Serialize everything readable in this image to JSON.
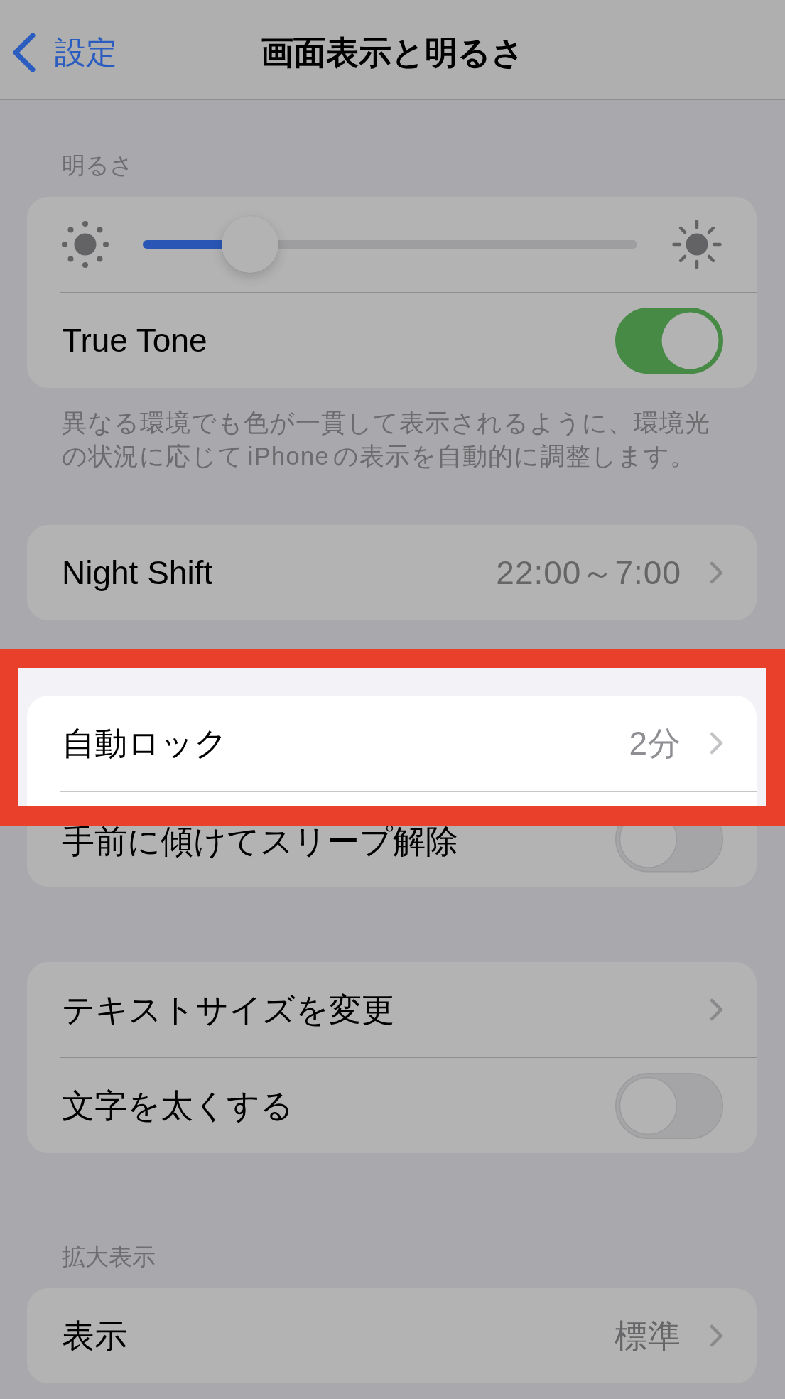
{
  "dimmed": true,
  "nav": {
    "back_label": "設定",
    "title": "画面表示と明るさ"
  },
  "groups": [
    {
      "header": "明るさ",
      "rows": [
        {
          "kind": "slider",
          "level": 0.18,
          "highlighted": false
        },
        {
          "kind": "toggle",
          "label": "True Tone",
          "on": true,
          "highlighted": false
        }
      ],
      "footer": "異なる環境でも色が一貫して表示されるように、環境光の状況に応じて iPhone の表示を自動的に調整します。"
    },
    {
      "rows": [
        {
          "kind": "link",
          "label": "Night Shift",
          "value": "22:00～7:00",
          "highlighted": false
        }
      ]
    },
    {
      "rows": [
        {
          "kind": "link",
          "label": "自動ロック",
          "value": "2分",
          "highlighted": true
        },
        {
          "kind": "toggle",
          "label": "手前に傾けてスリープ解除",
          "on": false,
          "highlighted": false
        }
      ]
    },
    {
      "rows": [
        {
          "kind": "link",
          "label": "テキストサイズを変更",
          "highlighted": false
        },
        {
          "kind": "toggle",
          "label": "文字を太くする",
          "on": false,
          "highlighted": false
        }
      ]
    },
    {
      "header": "拡大表示",
      "rows": [
        {
          "kind": "link",
          "label": "表示",
          "value": "標準",
          "highlighted": false
        }
      ]
    }
  ]
}
